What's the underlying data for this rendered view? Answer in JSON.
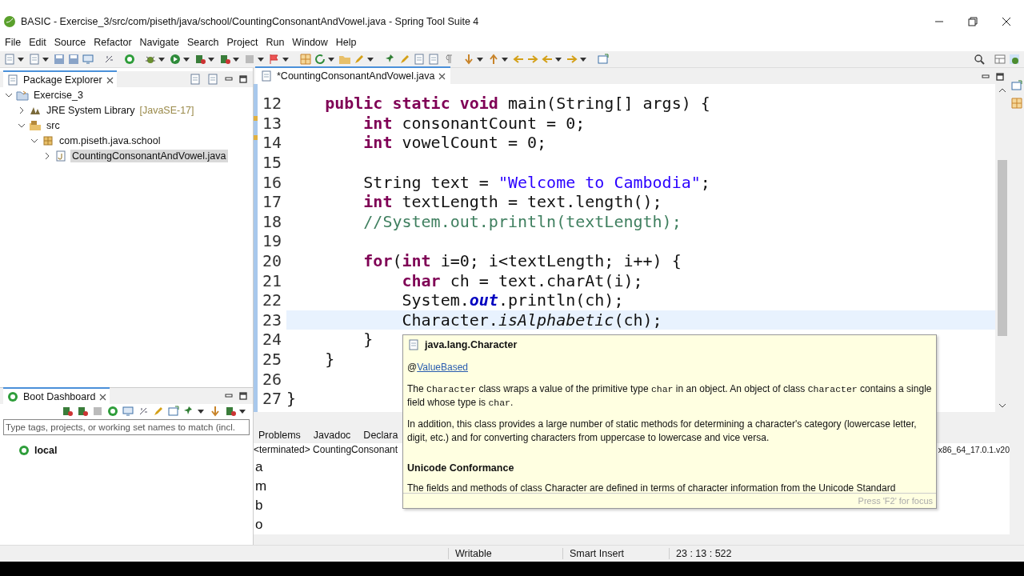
{
  "window": {
    "title": "BASIC - Exercise_3/src/com/piseth/java/school/CountingConsonantAndVowel.java - Spring Tool Suite 4"
  },
  "menu": [
    "File",
    "Edit",
    "Source",
    "Refactor",
    "Navigate",
    "Search",
    "Project",
    "Run",
    "Window",
    "Help"
  ],
  "package_explorer": {
    "title": "Package Explorer",
    "tree": [
      {
        "label": "Exercise_3",
        "kind": "project",
        "expanded": true,
        "selected": false,
        "children": [
          {
            "label": "JRE System Library",
            "decoration": "[JavaSE-17]",
            "kind": "library",
            "expanded": false,
            "selected": false
          },
          {
            "label": "src",
            "kind": "folder",
            "expanded": true,
            "selected": false,
            "children": [
              {
                "label": "com.piseth.java.school",
                "kind": "package",
                "expanded": true,
                "selected": false,
                "children": [
                  {
                    "label": "CountingConsonantAndVowel.java",
                    "kind": "file",
                    "expanded": false,
                    "selected": true
                  }
                ]
              }
            ]
          }
        ]
      }
    ]
  },
  "boot_dashboard": {
    "title": "Boot Dashboard",
    "search": {
      "placeholder": "Type tags, projects, or working set names to match (incl."
    },
    "items": [
      {
        "label": "local"
      }
    ]
  },
  "editor": {
    "tab": {
      "label": "*CountingConsonantAndVowel.java",
      "selected": true
    },
    "lines": [
      {
        "number": "12",
        "current": false,
        "warning": false,
        "segments": [
          {
            "kind": "keyword",
            "text": "    public static void"
          },
          {
            "kind": "plain",
            "text": " main(String[] args) {"
          }
        ]
      },
      {
        "number": "13",
        "current": false,
        "warning": true,
        "segments": [
          {
            "kind": "keyword",
            "text": "        int"
          },
          {
            "kind": "plain",
            "text": " consonantCount = 0;"
          }
        ]
      },
      {
        "number": "14",
        "current": false,
        "warning": true,
        "segments": [
          {
            "kind": "keyword",
            "text": "        int"
          },
          {
            "kind": "plain",
            "text": " vowelCount = 0;"
          }
        ]
      },
      {
        "number": "15",
        "current": false,
        "warning": false
      },
      {
        "number": "16",
        "current": false,
        "warning": false,
        "segments": [
          {
            "kind": "plain",
            "text": "        String text = "
          },
          {
            "kind": "string",
            "text": "\"Welcome to Cambodia\""
          },
          {
            "kind": "plain",
            "text": ";"
          }
        ]
      },
      {
        "number": "17",
        "current": false,
        "warning": false,
        "segments": [
          {
            "kind": "keyword",
            "text": "        int"
          },
          {
            "kind": "plain",
            "text": " textLength = text.length();"
          }
        ]
      },
      {
        "number": "18",
        "current": false,
        "warning": false,
        "segments": [
          {
            "kind": "comment",
            "text": "        //System.out.println(textLength);"
          }
        ]
      },
      {
        "number": "19",
        "current": false,
        "warning": false
      },
      {
        "number": "20",
        "current": false,
        "warning": false,
        "segments": [
          {
            "kind": "keyword",
            "text": "        for"
          },
          {
            "kind": "plain",
            "text": "("
          },
          {
            "kind": "keyword",
            "text": "int"
          },
          {
            "kind": "plain",
            "text": " i=0; i<textLength; i++) {"
          }
        ]
      },
      {
        "number": "21",
        "current": false,
        "warning": false,
        "segments": [
          {
            "kind": "keyword",
            "text": "            char"
          },
          {
            "kind": "plain",
            "text": " ch = text.charAt(i);"
          }
        ]
      },
      {
        "number": "22",
        "current": false,
        "warning": false,
        "segments": [
          {
            "kind": "plain",
            "text": "            System."
          },
          {
            "kind": "field",
            "text": "out"
          },
          {
            "kind": "plain",
            "text": ".println(ch);"
          }
        ]
      },
      {
        "number": "23",
        "current": true,
        "warning": false,
        "segments": [
          {
            "kind": "plain",
            "text": "            Character."
          },
          {
            "kind": "static",
            "text": "isAlphabetic"
          },
          {
            "kind": "plain",
            "text": "(ch);"
          }
        ]
      },
      {
        "number": "24",
        "current": false,
        "warning": false,
        "segments": [
          {
            "kind": "plain",
            "text": "        }"
          }
        ]
      },
      {
        "number": "25",
        "current": false,
        "warning": false,
        "segments": [
          {
            "kind": "plain",
            "text": "    }"
          }
        ]
      },
      {
        "number": "26",
        "current": false,
        "warning": false
      },
      {
        "number": "27",
        "current": false,
        "warning": false,
        "segments": [
          {
            "kind": "plain",
            "text": "}"
          }
        ]
      }
    ]
  },
  "hover": {
    "title": "java.lang.Character",
    "annotation_prefix": "@",
    "annotation": "ValueBased",
    "paragraphs": [
      [
        {
          "kind": "text",
          "text": "The "
        },
        {
          "kind": "code",
          "text": "Character"
        },
        {
          "kind": "text",
          "text": " class wraps a value of the primitive type "
        },
        {
          "kind": "code",
          "text": "char"
        },
        {
          "kind": "text",
          "text": " in an object. An object of class "
        },
        {
          "kind": "code",
          "text": "Character"
        },
        {
          "kind": "text",
          "text": " contains a single field whose type is "
        },
        {
          "kind": "code",
          "text": "char"
        },
        {
          "kind": "text",
          "text": "."
        }
      ],
      [
        {
          "kind": "text",
          "text": "In addition, this class provides a large number of static methods for determining a character's category (lowercase letter, digit, etc.) and for converting characters from uppercase to lowercase and vice versa."
        }
      ]
    ],
    "heading": "Unicode Conformance",
    "cut_line": "The fields and methods of class Character are defined in terms of character information from the Unicode Standard",
    "footer": "Press 'F2' for focus"
  },
  "console": {
    "tabs": [
      {
        "label": "Problems",
        "selected": false
      },
      {
        "label": "Javadoc",
        "selected": false
      },
      {
        "label": "Declara",
        "selected": false
      }
    ],
    "process": "<terminated> CountingConsonant",
    "process_tail": "x86_64_17.0.1.v20",
    "output": [
      "a",
      "m",
      "b",
      "o"
    ]
  },
  "status_bar": {
    "mode": "Writable",
    "insert": "Smart Insert",
    "position": "23 : 13 : 522"
  }
}
